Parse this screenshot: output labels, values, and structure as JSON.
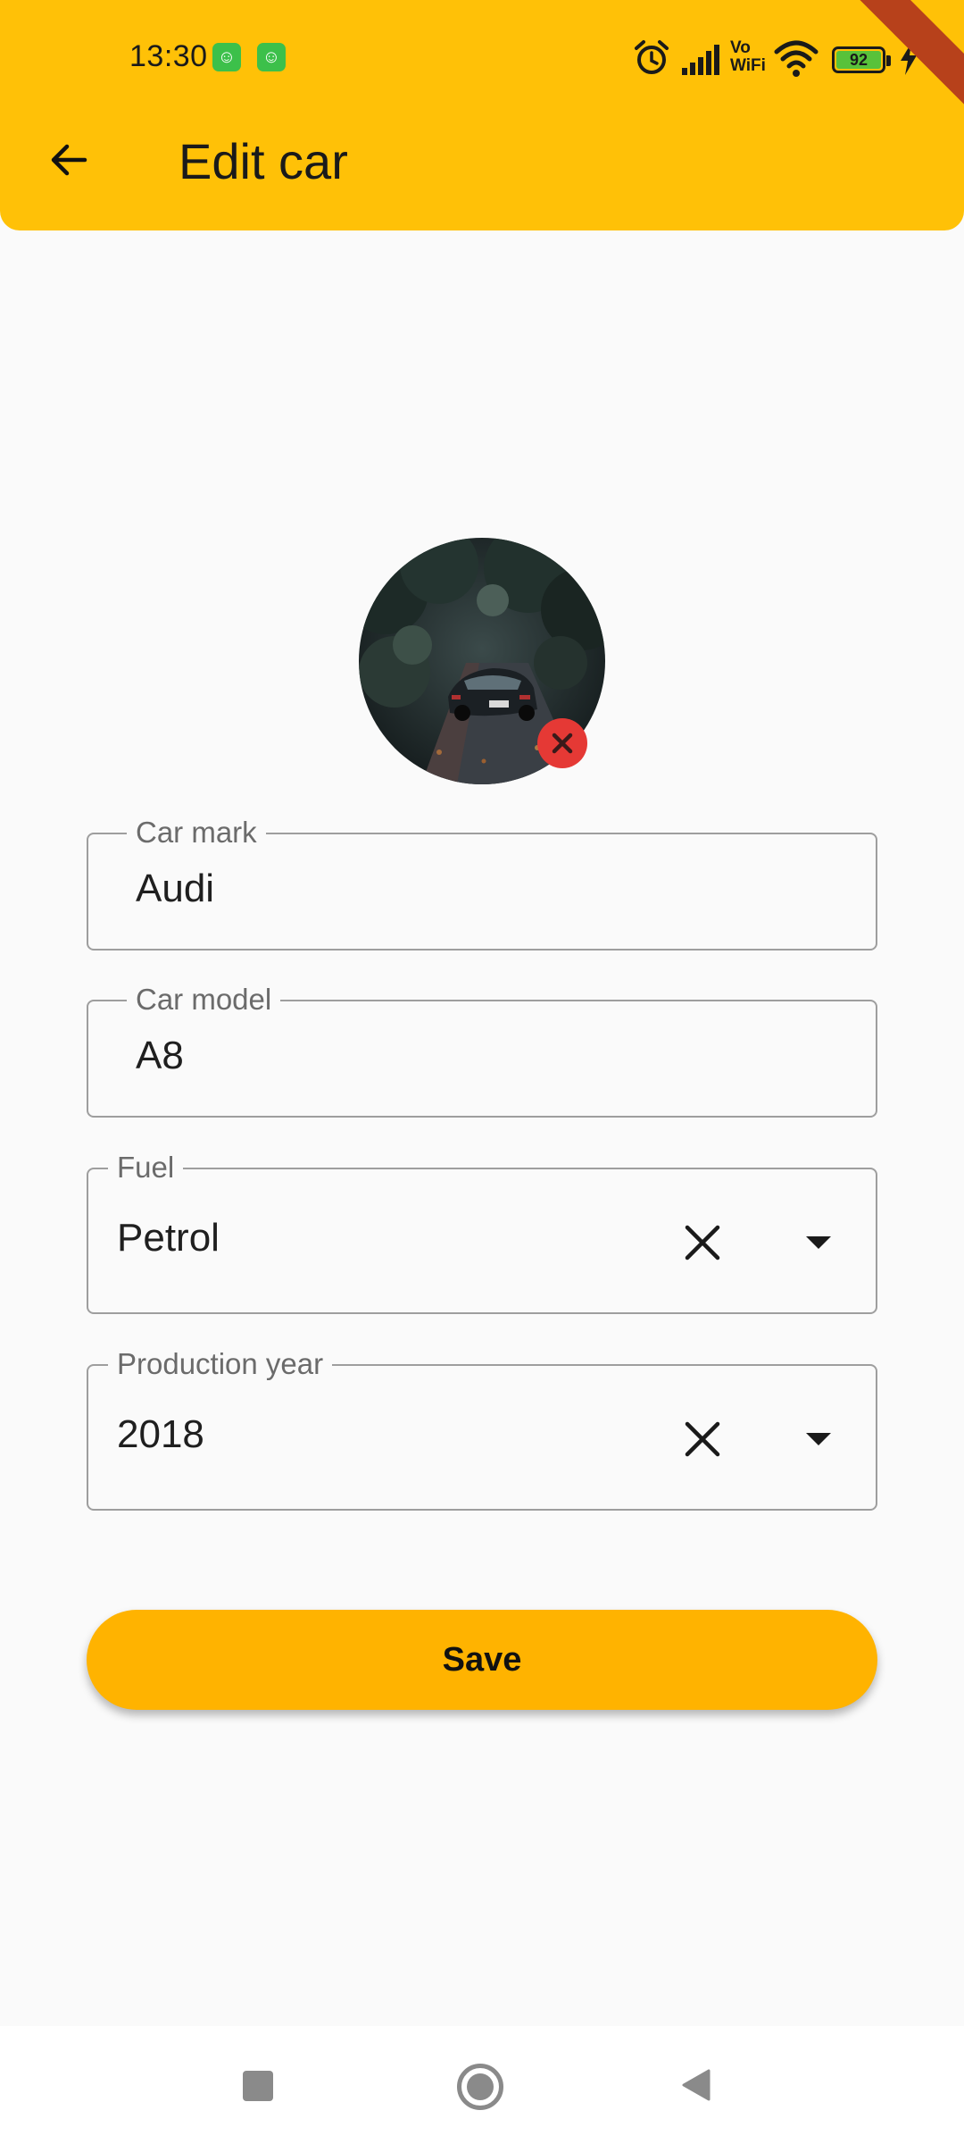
{
  "status_bar": {
    "time": "13:30",
    "battery_level": "92",
    "network_label": "Vo WiFi"
  },
  "app_bar": {
    "title": "Edit car",
    "background_color": "#ffc107"
  },
  "form": {
    "car_mark": {
      "label": "Car mark",
      "value": "Audi"
    },
    "car_model": {
      "label": "Car model",
      "value": "A8"
    },
    "fuel": {
      "label": "Fuel",
      "value": "Petrol"
    },
    "production_year": {
      "label": "Production year",
      "value": "2018"
    }
  },
  "actions": {
    "save_label": "Save",
    "save_color": "#ffb300",
    "remove_photo_color": "#e53935"
  },
  "icons": {
    "back": "arrow-left-icon",
    "clear": "close-icon",
    "dropdown": "caret-down-icon",
    "remove_photo": "close-icon"
  }
}
